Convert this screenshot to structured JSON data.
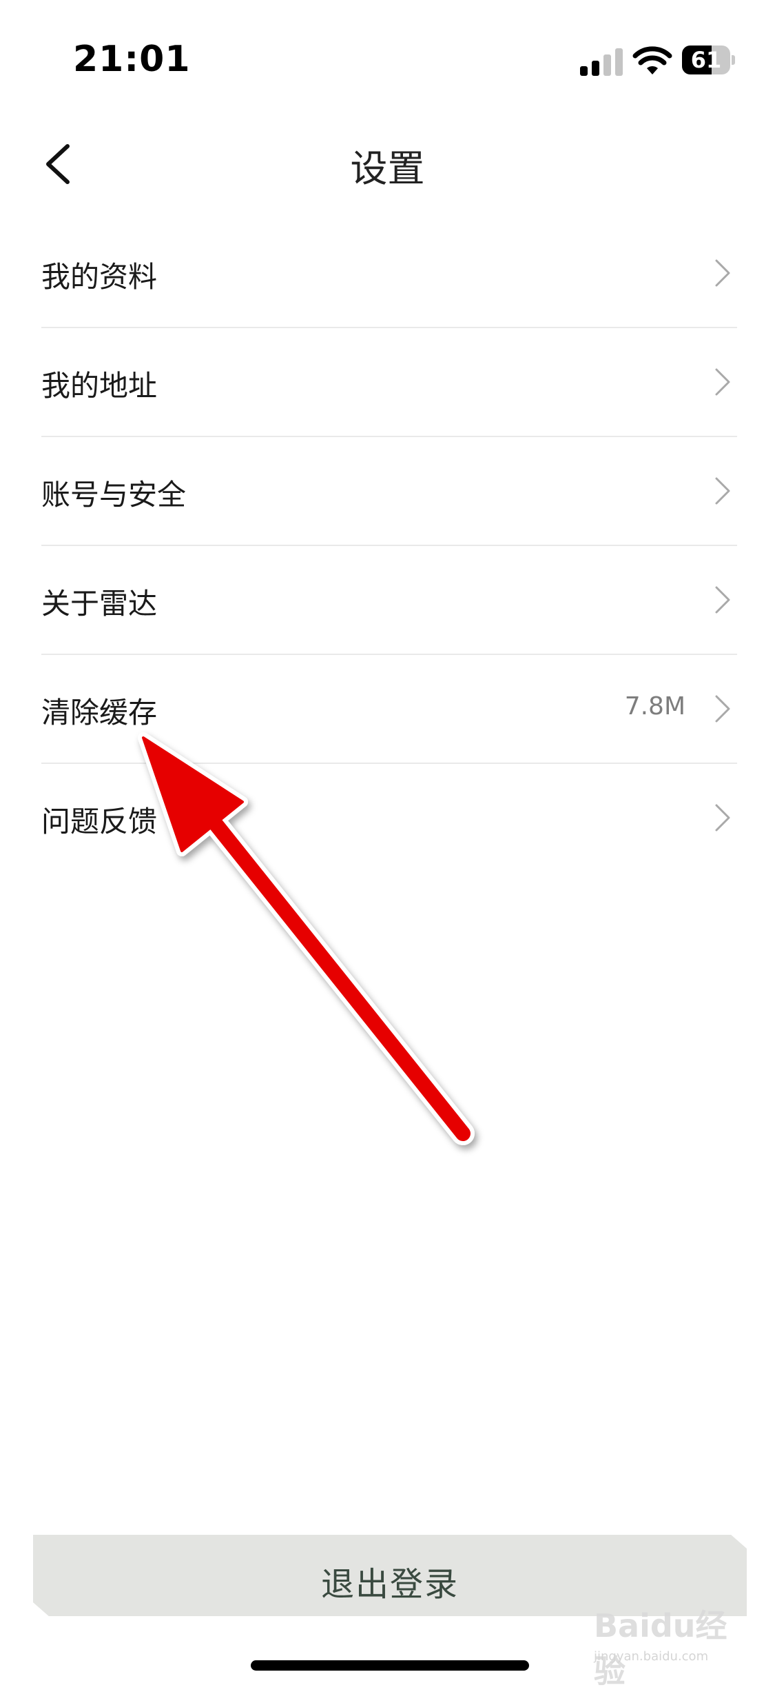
{
  "status_bar": {
    "time": "21:01",
    "battery_level": "61",
    "battery_fraction": 0.61,
    "signal_bars_active": 2,
    "signal_bars_total": 4
  },
  "nav": {
    "title": "设置",
    "back_icon": "chevron-left-icon"
  },
  "settings": {
    "items": [
      {
        "label": "我的资料",
        "value": ""
      },
      {
        "label": "我的地址",
        "value": ""
      },
      {
        "label": "账号与安全",
        "value": ""
      },
      {
        "label": "关于雷达",
        "value": ""
      },
      {
        "label": "清除缓存",
        "value": "7.8M"
      },
      {
        "label": "问题反馈",
        "value": ""
      }
    ]
  },
  "logout": {
    "label": "退出登录"
  },
  "watermark": {
    "brand": "Baidu经验",
    "url": "jingyan.baidu.com"
  },
  "annotation": {
    "color": "#e60000",
    "target": "清除缓存"
  }
}
